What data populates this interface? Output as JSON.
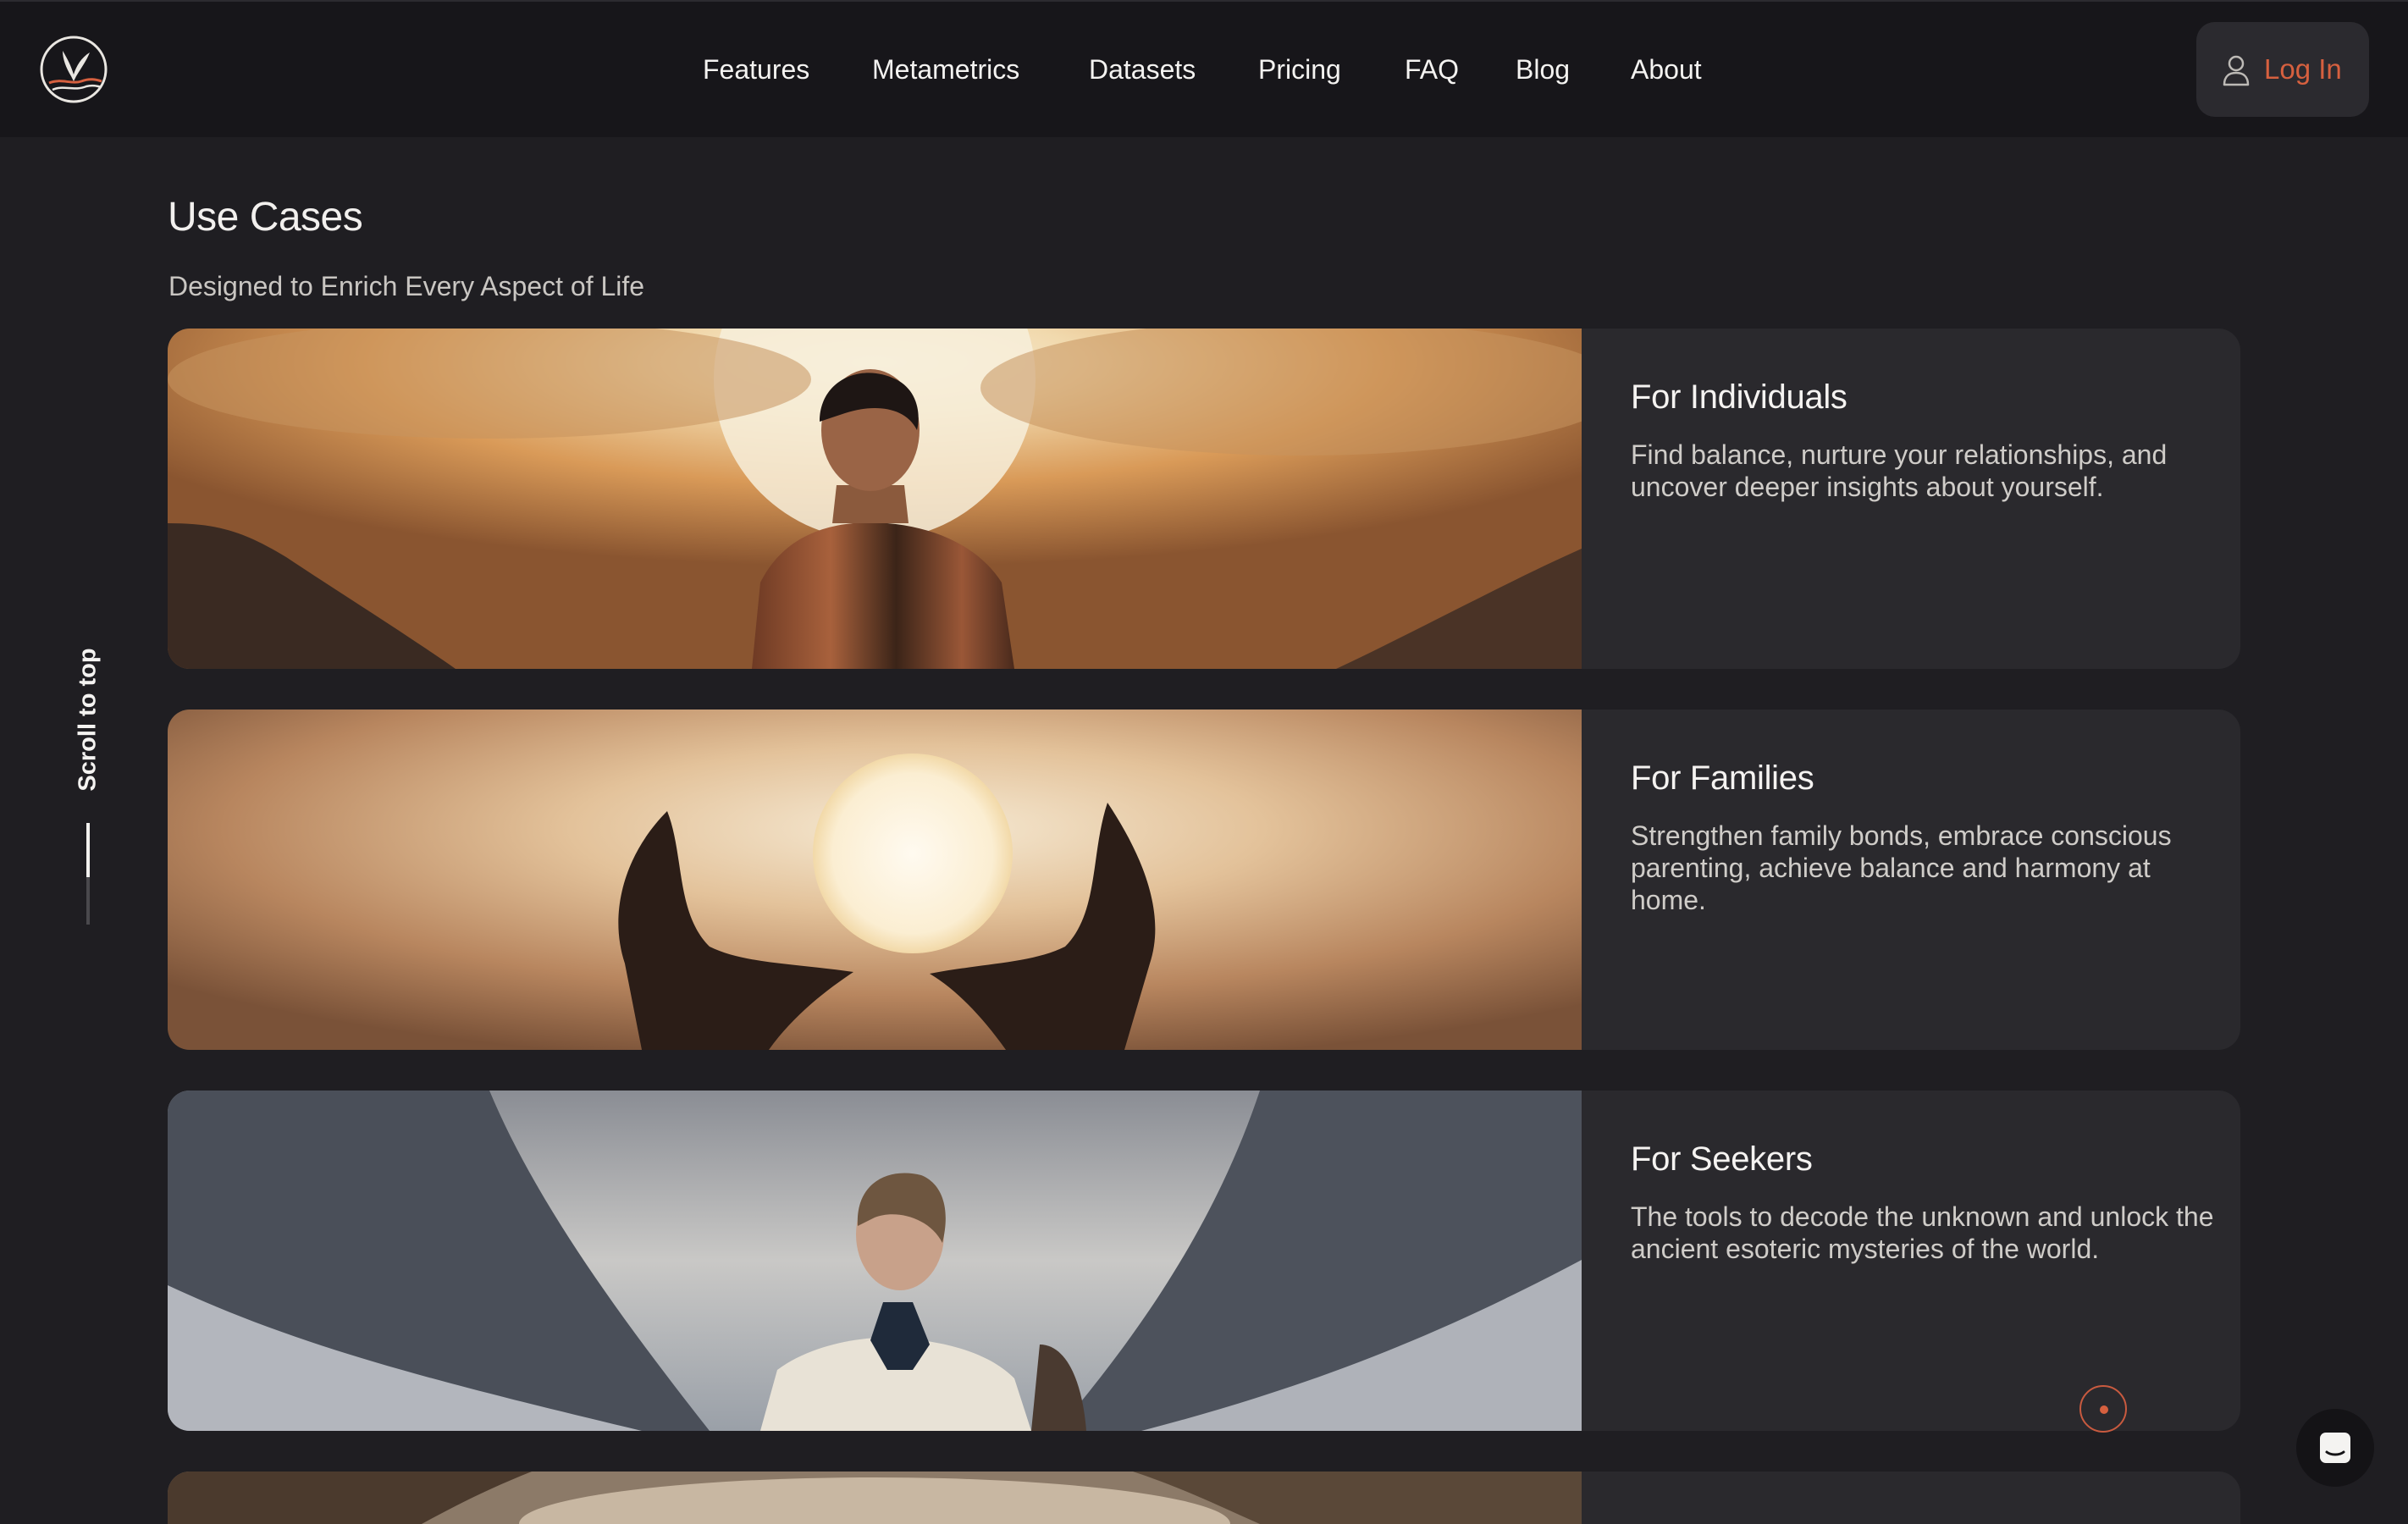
{
  "header": {
    "logo_icon": "whale-tail-logo-icon",
    "nav": [
      "Features",
      "Metametrics",
      "Datasets",
      "Pricing",
      "FAQ",
      "Blog",
      "About"
    ],
    "login_label": "Log In",
    "login_icon": "user-icon",
    "accent_color": "#d6603f"
  },
  "section": {
    "title": "Use Cases",
    "subtitle": "Designed to Enrich Every Aspect of Life"
  },
  "cards": [
    {
      "title": "For Individuals",
      "description": "Find balance, nurture your relationships, and uncover deeper insights about yourself."
    },
    {
      "title": "For Families",
      "description": "Strengthen family bonds, embrace conscious parenting, achieve balance and harmony at home."
    },
    {
      "title": "For Seekers",
      "description": "The tools to decode the unknown and unlock the ancient esoteric mysteries of the world."
    }
  ],
  "sidebar": {
    "scroll_label": "Scroll to top",
    "scroll_progress": 0.53
  },
  "widgets": {
    "chat_icon": "chat-bubble-icon",
    "marker_icon": "record-dot-icon"
  }
}
